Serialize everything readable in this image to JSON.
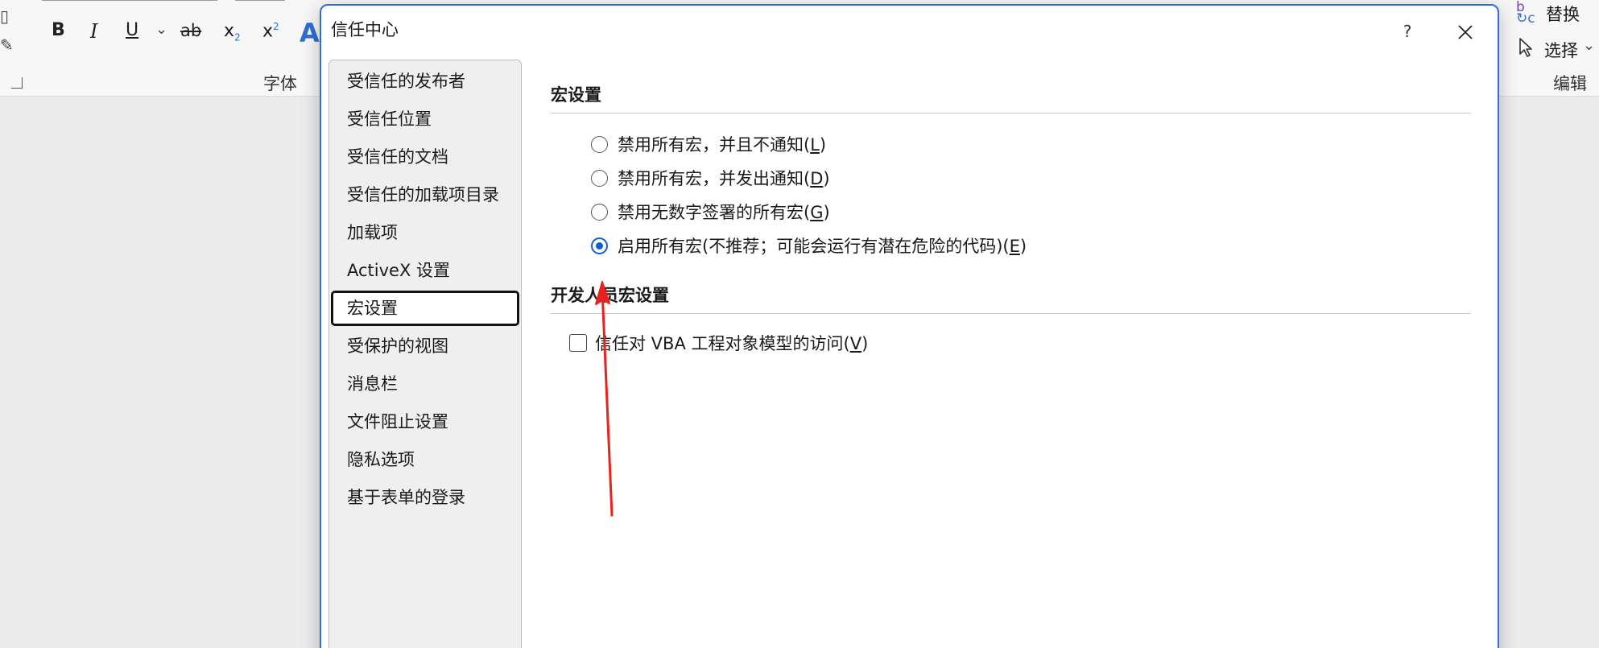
{
  "ribbon": {
    "font_group_label": "字体",
    "edit_group_label": "编辑",
    "bold": "B",
    "italic": "I",
    "underline": "U",
    "chevron": "⌄",
    "strike": "ab",
    "subscript_base": "x",
    "subscript_mark": "2",
    "superscript_base": "x",
    "superscript_mark": "2",
    "text_effect": "A",
    "replace_label": "替换",
    "select_label": "选择"
  },
  "dialog": {
    "title": "信任中心",
    "help": "?",
    "nav_items": [
      "受信任的发布者",
      "受信任位置",
      "受信任的文档",
      "受信任的加载项目录",
      "加载项",
      "ActiveX 设置",
      "宏设置",
      "受保护的视图",
      "消息栏",
      "文件阻止设置",
      "隐私选项",
      "基于表单的登录"
    ],
    "selected_nav": "宏设置",
    "macro_section_title": "宏设置",
    "macro_options": [
      {
        "text": "禁用所有宏，并且不通知(",
        "key": "L",
        "end": ")",
        "checked": false
      },
      {
        "text": "禁用所有宏，并发出通知(",
        "key": "D",
        "end": ")",
        "checked": false
      },
      {
        "text": "禁用无数字签署的所有宏(",
        "key": "G",
        "end": ")",
        "checked": false
      },
      {
        "text": "启用所有宏(不推荐；可能会运行有潜在危险的代码)(",
        "key": "E",
        "end": ")",
        "checked": true
      }
    ],
    "developer_section_title": "开发人员宏设置",
    "vba_access": {
      "text": "信任对 VBA 工程对象模型的访问(",
      "key": "V",
      "end": ")",
      "checked": false
    }
  },
  "colors": {
    "accent": "#0f5fd4",
    "dialog_border": "#2d6fd6",
    "annotation_arrow": "#e8231f"
  }
}
